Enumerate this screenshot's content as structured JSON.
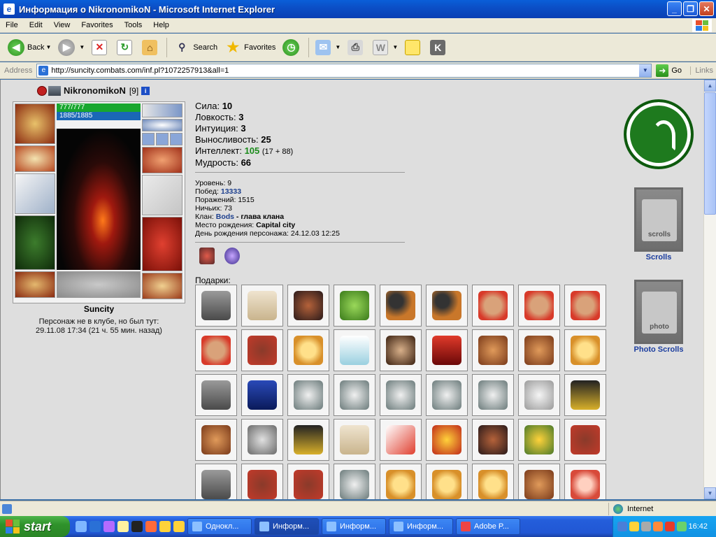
{
  "window": {
    "title": "Информация о NikronomikoN - Microsoft Internet Explorer"
  },
  "menu": [
    "File",
    "Edit",
    "View",
    "Favorites",
    "Tools",
    "Help"
  ],
  "toolbar": {
    "back": "Back",
    "search": "Search",
    "favorites": "Favorites"
  },
  "address": {
    "label": "Address",
    "url": "http://suncity.combats.com/inf.pl?1072257913&all=1",
    "go": "Go",
    "links": "Links"
  },
  "character": {
    "nick": "NikronomikoN",
    "level": "[9]",
    "hp": "777/777",
    "mana": "1885/1885",
    "city": "Suncity",
    "offline_line1": "Персонаж не в клубе, но был тут:",
    "offline_line2": "29.11.08 17:34 (21 ч. 55 мин. назад)"
  },
  "stats": [
    {
      "label": "Сила:",
      "value": "10",
      "extra": ""
    },
    {
      "label": "Ловкость:",
      "value": "3",
      "extra": ""
    },
    {
      "label": "Интуиция:",
      "value": "3",
      "extra": ""
    },
    {
      "label": "Выносливость:",
      "value": "25",
      "extra": ""
    },
    {
      "label": "Интеллект:",
      "value": "105",
      "extra": "(17 + 88)"
    },
    {
      "label": "Мудрость:",
      "value": "66",
      "extra": ""
    }
  ],
  "info": {
    "level_label": "Уровень:",
    "level": "9",
    "wins_label": "Побед:",
    "wins": "13333",
    "losses_label": "Поражений:",
    "losses": "1515",
    "draws_label": "Ничьих:",
    "draws": "73",
    "clan_label": "Клан:",
    "clan": "Bods",
    "clan_role": "- глава клана",
    "birthplace_label": "Место рождения:",
    "birthplace": "Capital city",
    "birthday_label": "День рождения персонажа:",
    "birthday": "24.12.03 12:25"
  },
  "gifts_label": "Подарки:",
  "gifts": [
    "cloak-grey",
    "scroll-paper",
    "helmet-dark",
    "goblin-green",
    "mace",
    "mace",
    "teddy-bear",
    "teddy-bear",
    "teddy-bear",
    "teddy-bear",
    "rocking-horse",
    "medal-gold",
    "crystal-sword",
    "bug-mask",
    "cloak-red",
    "beer-mug",
    "beer-mug",
    "medal-gold",
    "cloak-grey",
    "spell-book",
    "goblet-silver",
    "goblet-silver",
    "goblet-silver",
    "goblet-silver",
    "goblet-silver",
    "skull-goblet",
    "banner-5",
    "beer-mug",
    "statue-silver",
    "banner-5",
    "scroll-paper",
    "flag-5",
    "christmas-bells",
    "helmet-dark",
    "medal-ribbon",
    "rocking-horse",
    "cloak-grey",
    "rocking-horse",
    "rocking-horse",
    "goblet-silver",
    "medal-gold",
    "medal-gold",
    "medal-gold",
    "beer-mug",
    "crystal-ball"
  ],
  "sidebar": {
    "scrolls": "Scrolls",
    "photo_scrolls": "Photo Scrolls",
    "scrolls_banner": "scrolls",
    "photo_banner": "photo"
  },
  "status": {
    "zone": "Internet"
  },
  "taskbar": {
    "start": "start",
    "tasks": [
      "Однокл...",
      "Информ...",
      "Информ...",
      "Информ...",
      "Adobe P..."
    ],
    "clock": "16:42"
  },
  "colors": {
    "content_bg": "#dedede",
    "stat_green": "#1b8b1b",
    "link_blue": "#1c3f8e",
    "goat_green": "#1e7a1e"
  }
}
